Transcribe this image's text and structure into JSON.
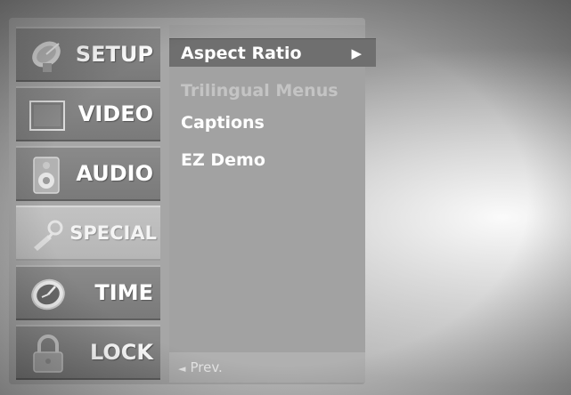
{
  "categories": [
    {
      "label": "SETUP",
      "icon": "satellite-dish-icon"
    },
    {
      "label": "VIDEO",
      "icon": "screen-icon"
    },
    {
      "label": "AUDIO",
      "icon": "speaker-icon"
    },
    {
      "label": "SPECIAL",
      "icon": "special-icon",
      "active": true
    },
    {
      "label": "TIME",
      "icon": "clock-icon"
    },
    {
      "label": "LOCK",
      "icon": "lock-icon"
    }
  ],
  "submenu": {
    "items": [
      {
        "label": "Aspect Ratio",
        "arrow": "▶",
        "selected": true
      },
      {
        "label": "Trilingual Menus",
        "disabled": true
      },
      {
        "label": "Captions"
      },
      {
        "label": "EZ Demo"
      }
    ],
    "prev_label": "Prev.",
    "prev_arrow": "◄"
  }
}
